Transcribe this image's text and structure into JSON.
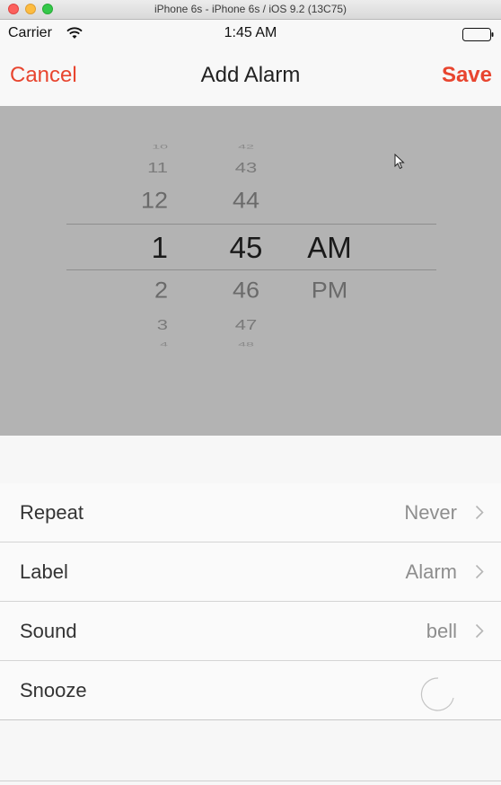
{
  "window": {
    "title": "iPhone 6s - iPhone 6s / iOS 9.2 (13C75)"
  },
  "status_bar": {
    "carrier": "Carrier",
    "time": "1:45 AM",
    "icons": [
      "wifi-icon",
      "battery-icon"
    ]
  },
  "nav": {
    "cancel_label": "Cancel",
    "title": "Add Alarm",
    "save_label": "Save"
  },
  "picker": {
    "hours": {
      "above3": "10",
      "above2": "11",
      "above1": "12",
      "selected": "1",
      "below1": "2",
      "below2": "3",
      "below3": "4"
    },
    "minutes": {
      "above3": "42",
      "above2": "43",
      "above1": "44",
      "selected": "45",
      "below1": "46",
      "below2": "47",
      "below3": "48"
    },
    "ampm": {
      "selected": "AM",
      "below1": "PM"
    }
  },
  "settings": {
    "repeat": {
      "label": "Repeat",
      "value": "Never"
    },
    "label": {
      "label": "Label",
      "value": "Alarm"
    },
    "sound": {
      "label": "Sound",
      "value": "bell"
    },
    "snooze": {
      "label": "Snooze",
      "enabled": true
    }
  },
  "colors": {
    "accent": "#e8452f",
    "picker_bg": "#b3b3b3"
  }
}
